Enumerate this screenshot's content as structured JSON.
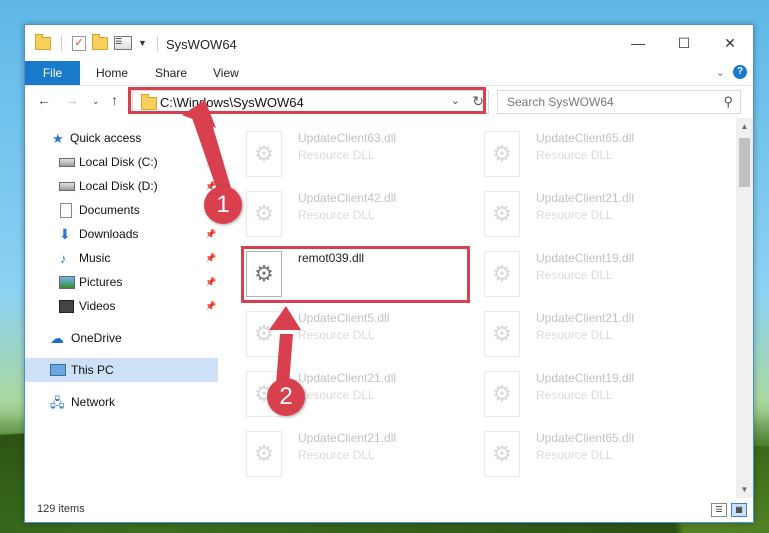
{
  "window": {
    "title": "SysWOW64",
    "min_icon": "minimize-icon",
    "max_icon": "maximize-icon",
    "close_icon": "close-icon"
  },
  "ribbon": {
    "file_tab": "File",
    "tabs": [
      "Home",
      "Share",
      "View"
    ]
  },
  "address": {
    "path": "C:\\Windows\\SysWOW64",
    "search_placeholder": "Search SysWOW64"
  },
  "sidebar": {
    "items": [
      {
        "label": "Quick access",
        "icon": "star-icon"
      },
      {
        "label": "Local Disk (C:)",
        "icon": "drive-icon",
        "pinned": true
      },
      {
        "label": "Local Disk (D:)",
        "icon": "drive-icon",
        "pinned": true
      },
      {
        "label": "Documents",
        "icon": "documents-icon",
        "pinned": true
      },
      {
        "label": "Downloads",
        "icon": "downloads-icon",
        "pinned": true
      },
      {
        "label": "Music",
        "icon": "music-icon",
        "pinned": true
      },
      {
        "label": "Pictures",
        "icon": "pictures-icon",
        "pinned": true
      },
      {
        "label": "Videos",
        "icon": "videos-icon",
        "pinned": true
      },
      {
        "label": "OneDrive",
        "icon": "onedrive-icon"
      },
      {
        "label": "This PC",
        "icon": "computer-icon",
        "selected": true
      },
      {
        "label": "Network",
        "icon": "network-icon"
      }
    ]
  },
  "files": [
    {
      "name": "UpdateClient63.dll",
      "type": "Resource DLL",
      "dim": true
    },
    {
      "name": "UpdateClient65.dll",
      "type": "Resource DLL",
      "dim": true
    },
    {
      "name": "UpdateClient42.dll",
      "type": "Resource DLL",
      "dim": true
    },
    {
      "name": "UpdateClient21.dll",
      "type": "Resource DLL",
      "dim": true
    },
    {
      "name": "remot039.dll",
      "type": "",
      "dim": false
    },
    {
      "name": "UpdateClient19.dll",
      "type": "Resource DLL",
      "dim": true
    },
    {
      "name": "UpdateClient5.dll",
      "type": "Resource DLL",
      "dim": true
    },
    {
      "name": "UpdateClient21.dll",
      "type": "Resource DLL",
      "dim": true
    },
    {
      "name": "UpdateClient21.dll",
      "type": "Resource DLL",
      "dim": true
    },
    {
      "name": "UpdateClient19.dll",
      "type": "Resource DLL",
      "dim": true
    },
    {
      "name": "UpdateClient21.dll",
      "type": "Resource DLL",
      "dim": true
    },
    {
      "name": "UpdateClient65.dll",
      "type": "Resource DLL",
      "dim": true
    }
  ],
  "status": {
    "item_count": "129 items"
  },
  "annotations": {
    "step1": "1",
    "step2": "2",
    "color": "#d9404d"
  }
}
